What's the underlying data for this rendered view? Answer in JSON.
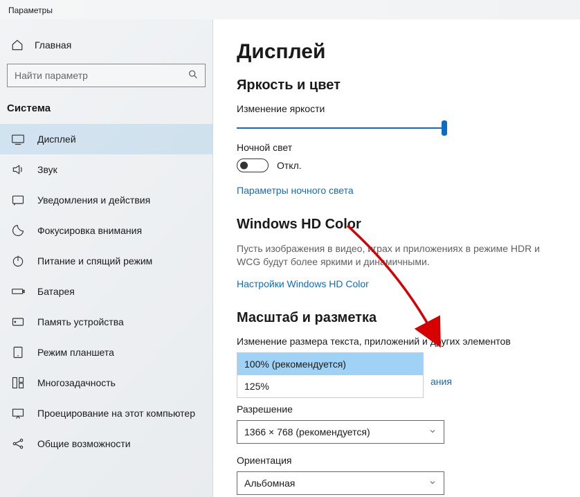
{
  "window": {
    "title": "Параметры"
  },
  "sidebar": {
    "home": "Главная",
    "search_placeholder": "Найти параметр",
    "section": "Система",
    "items": [
      {
        "label": "Дисплей"
      },
      {
        "label": "Звук"
      },
      {
        "label": "Уведомления и действия"
      },
      {
        "label": "Фокусировка внимания"
      },
      {
        "label": "Питание и спящий режим"
      },
      {
        "label": "Батарея"
      },
      {
        "label": "Память устройства"
      },
      {
        "label": "Режим планшета"
      },
      {
        "label": "Многозадачность"
      },
      {
        "label": "Проецирование на этот компьютер"
      },
      {
        "label": "Общие возможности"
      }
    ]
  },
  "main": {
    "title": "Дисплей",
    "brightness": {
      "section": "Яркость и цвет",
      "slider_label": "Изменение яркости",
      "slider_value": 100,
      "night_label": "Ночной свет",
      "night_state": "Откл.",
      "night_link": "Параметры ночного света"
    },
    "hdcolor": {
      "section": "Windows HD Color",
      "desc": "Пусть изображения в видео, играх и приложениях в режиме HDR и WCG будут более яркими и динамичными.",
      "link": "Настройки Windows HD Color"
    },
    "scale": {
      "section": "Масштаб и разметка",
      "scale_label": "Изменение размера текста, приложений и других элементов",
      "options": [
        "100% (рекомендуется)",
        "125%"
      ],
      "behind_link_fragment": "ания",
      "res_label": "Разрешение",
      "res_value": "1366 × 768 (рекомендуется)",
      "orient_label": "Ориентация",
      "orient_value": "Альбомная"
    }
  }
}
